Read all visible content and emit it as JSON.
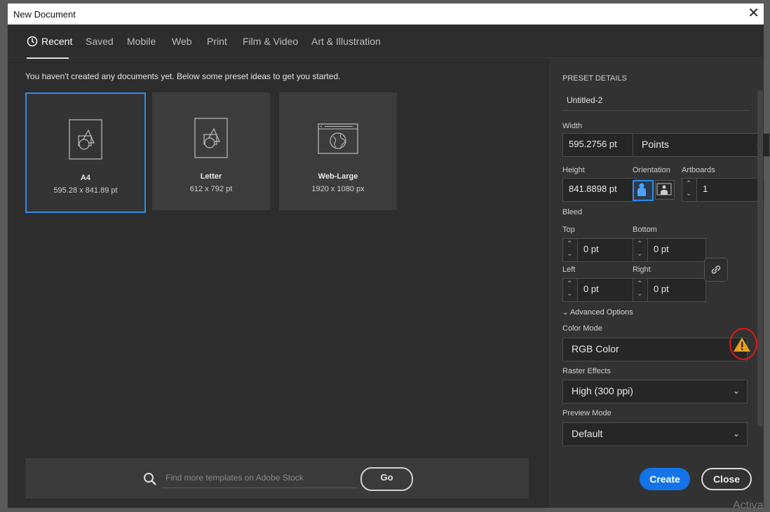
{
  "window": {
    "title": "New Document",
    "close_glyph": "✕"
  },
  "tabs": [
    {
      "label": "Recent"
    },
    {
      "label": "Saved"
    },
    {
      "label": "Mobile"
    },
    {
      "label": "Web"
    },
    {
      "label": "Print"
    },
    {
      "label": "Film & Video"
    },
    {
      "label": "Art & Illustration"
    }
  ],
  "intro_text": "You haven't created any documents yet. Below some preset ideas to get you started.",
  "presets": [
    {
      "name": "A4",
      "size": "595.28 x 841.89 pt",
      "icon": "document-shapes-icon"
    },
    {
      "name": "Letter",
      "size": "612 x 792 pt",
      "icon": "document-shapes-icon"
    },
    {
      "name": "Web-Large",
      "size": "1920 x 1080 px",
      "icon": "web-globe-icon"
    }
  ],
  "search": {
    "placeholder": "Find more templates on Adobe Stock",
    "go_label": "Go"
  },
  "details": {
    "heading": "PRESET DETAILS",
    "doc_name": "Untitled-2",
    "width_label": "Width",
    "width_value": "595.2756 pt",
    "units": "Points",
    "height_label": "Height",
    "height_value": "841.8898 pt",
    "orientation_label": "Orientation",
    "artboards_label": "Artboards",
    "artboards_value": "1",
    "bleed_label": "Bleed",
    "top_label": "Top",
    "top_value": "0 pt",
    "bottom_label": "Bottom",
    "bottom_value": "0 pt",
    "left_label": "Left",
    "left_value": "0 pt",
    "right_label": "Right",
    "right_value": "0 pt",
    "advanced_label": "Advanced Options",
    "color_mode_label": "Color Mode",
    "color_mode_value": "RGB Color",
    "raster_label": "Raster Effects",
    "raster_value": "High (300 ppi)",
    "preview_label": "Preview Mode",
    "preview_value": "Default"
  },
  "actions": {
    "create": "Create",
    "close": "Close"
  },
  "watermark": "Activa",
  "colors": {
    "accent": "#1473e6",
    "selected_border": "#2d8ceb",
    "warning": "#e8a020",
    "annotation_ring": "#e01818"
  }
}
